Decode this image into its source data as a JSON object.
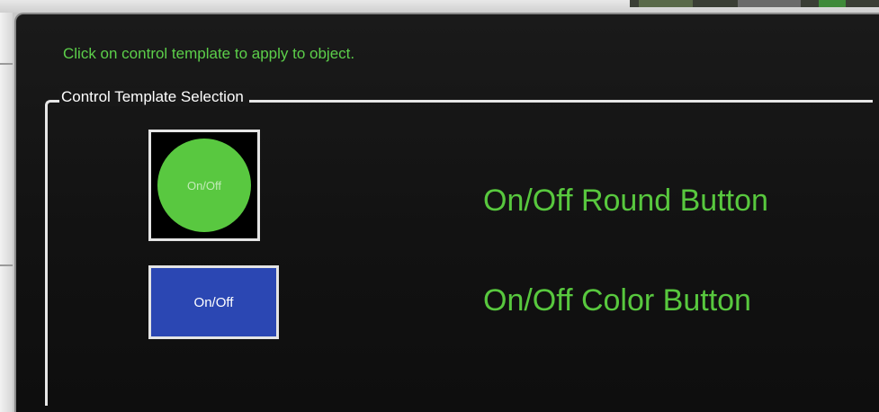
{
  "dialog": {
    "instruction": "Click on control template to apply to object.",
    "group_title": "Control Template Selection"
  },
  "templates": [
    {
      "preview_label": "On/Off",
      "name": "On/Off Round Button",
      "preview_color": "#59c840"
    },
    {
      "preview_label": "On/Off",
      "name": "On/Off Color Button",
      "preview_color": "#2b47b3"
    }
  ],
  "colors": {
    "accent_text": "#58c83e",
    "dialog_bg": "#141414",
    "border": "#e6e6e6"
  }
}
